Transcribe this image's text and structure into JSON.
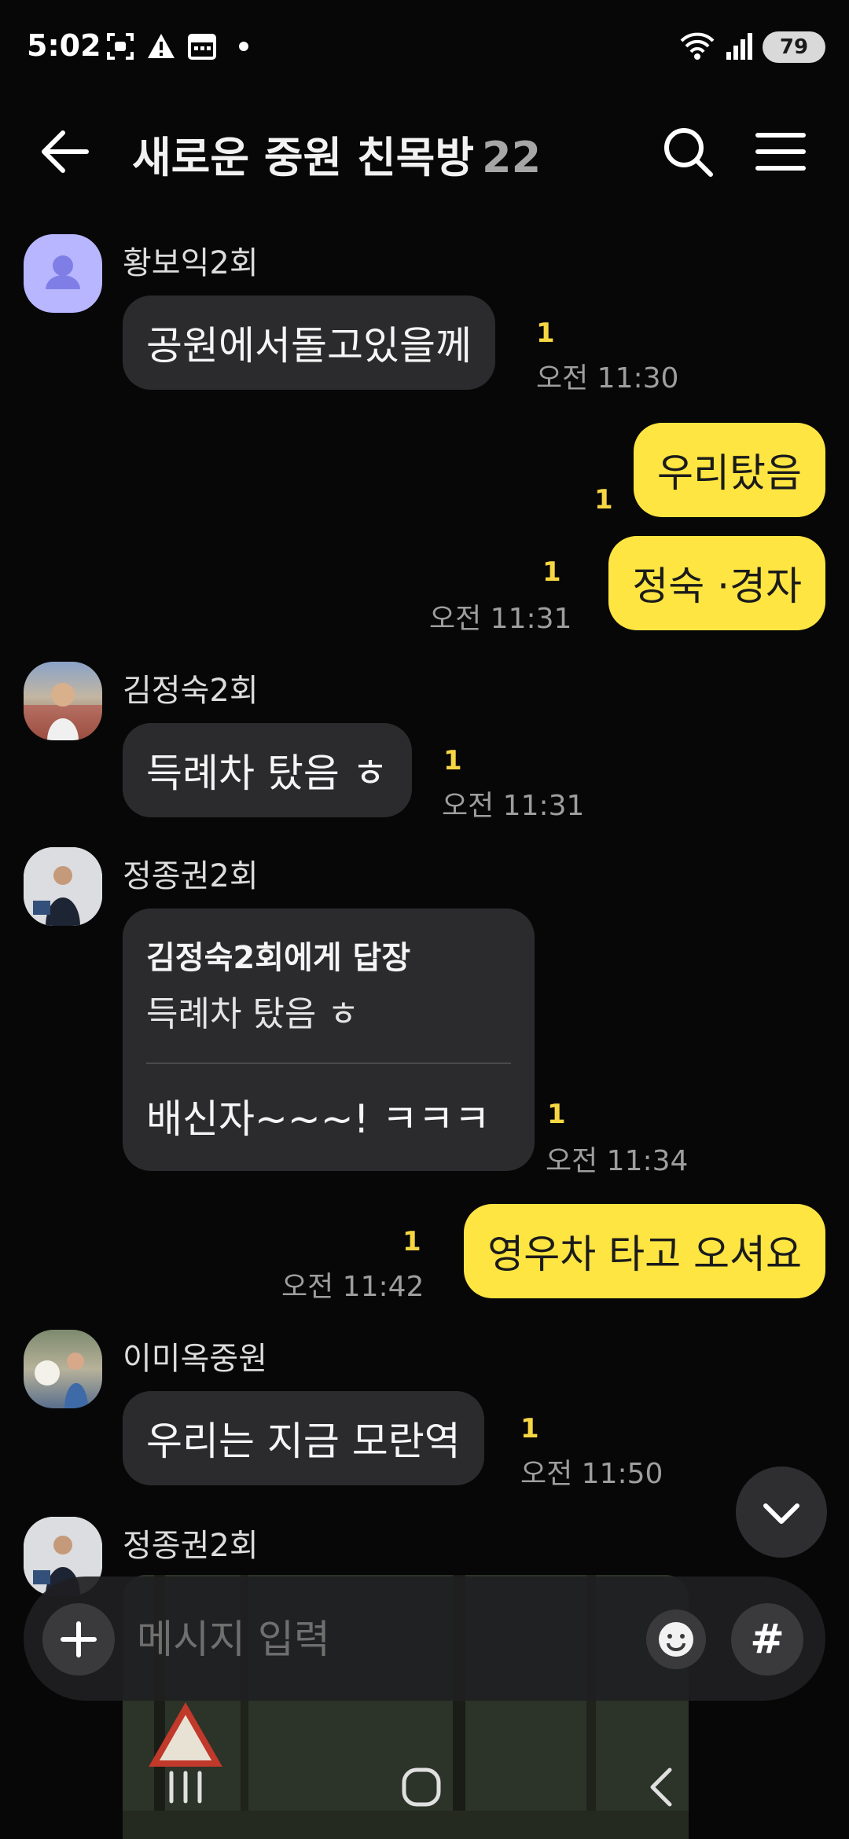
{
  "status_bar": {
    "time": "5:02",
    "battery": "79"
  },
  "header": {
    "title": "새로운 중원 친목방",
    "member_count": "22"
  },
  "messages": [
    {
      "sender": "황보익2회",
      "text": "공원에서돌고있을께",
      "unread": "1",
      "time": "오전 11:30"
    },
    {
      "text": "우리탔음",
      "unread": "1"
    },
    {
      "text": "정숙 ·경자",
      "unread": "1",
      "time": "오전 11:31"
    },
    {
      "sender": "김정숙2회",
      "text": "득례차 탔음 ㅎ",
      "unread": "1",
      "time": "오전 11:31"
    },
    {
      "sender": "정종권2회",
      "reply_to": "김정숙2회에게 답장",
      "quote": "득례차 탔음 ㅎ",
      "text": "배신자~~~!  ㅋㅋㅋ",
      "unread": "1",
      "time": "오전 11:34"
    },
    {
      "text": "영우차  타고 오셔요",
      "unread": "1",
      "time": "오전 11:42"
    },
    {
      "sender": "이미옥중원",
      "text": "우리는 지금 모란역",
      "unread": "1",
      "time": "오전 11:50"
    },
    {
      "sender": "정종권2회"
    }
  ],
  "input": {
    "placeholder": "메시지 입력",
    "hash_label": "#"
  },
  "colors": {
    "background": "#070707",
    "incoming_bubble": "#2b2b2d",
    "outgoing_bubble": "#fee541",
    "unread": "#f6d743"
  },
  "icons": [
    "back-arrow-icon",
    "search-icon",
    "menu-icon",
    "chevron-down-icon",
    "plus-icon",
    "emoji-icon",
    "recents-icon",
    "home-icon",
    "nav-back-icon"
  ]
}
